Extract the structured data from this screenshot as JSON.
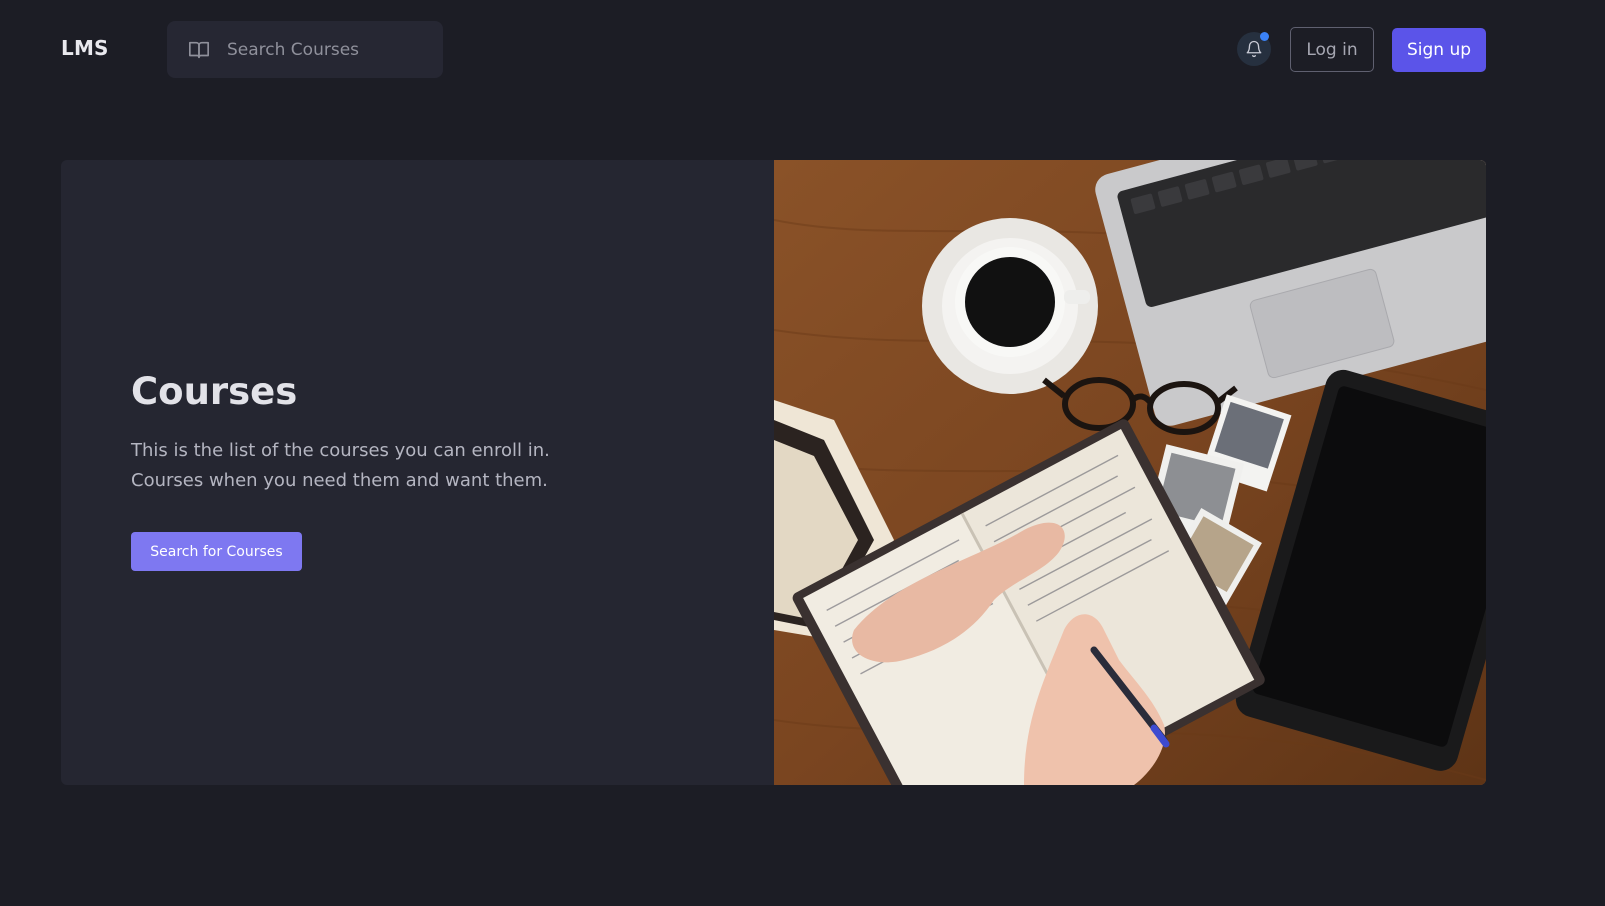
{
  "header": {
    "logo": "LMS",
    "search": {
      "placeholder": "Search Courses",
      "icon": "book-open-icon"
    },
    "notifications": {
      "icon": "bell-icon",
      "has_unread": true
    },
    "login_label": "Log in",
    "signup_label": "Sign up"
  },
  "hero": {
    "title": "Courses",
    "description_line1": "This is the list of the courses you can enroll in.",
    "description_line2": "Courses when you need them and want them.",
    "cta_label": "Search for Courses",
    "image": {
      "alt": "Desk with laptop, coffee, glasses, notebook and tablet"
    }
  },
  "colors": {
    "background": "#1c1d25",
    "panel": "#252631",
    "primary": "#5b54e9",
    "cta": "#7e78f1",
    "notification_dot": "#3b82f6"
  }
}
